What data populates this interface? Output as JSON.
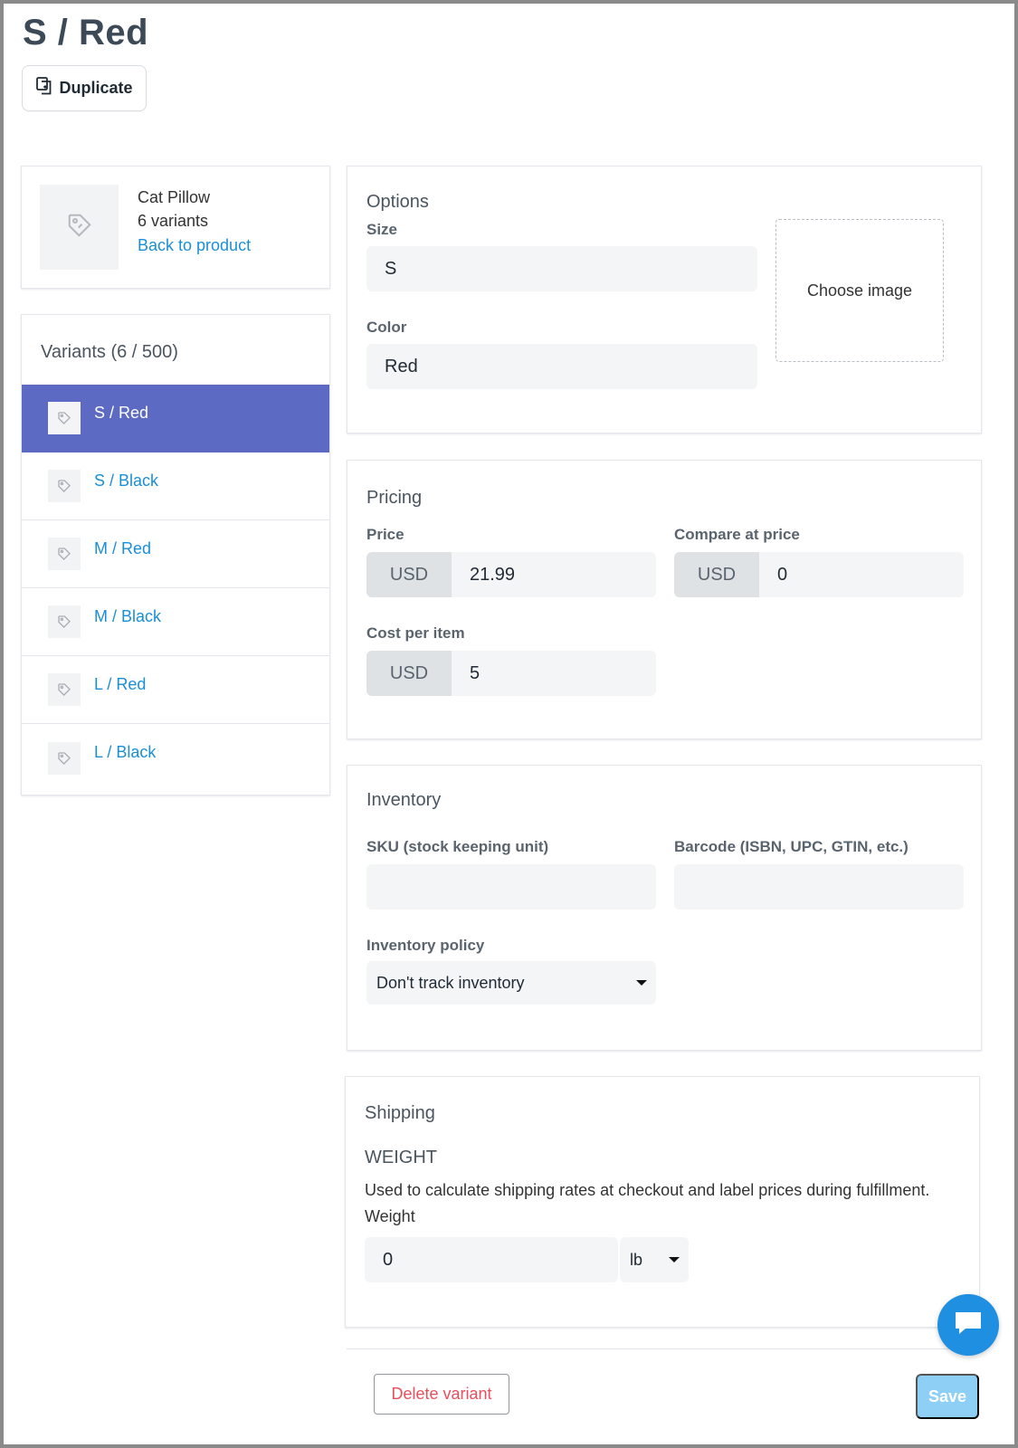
{
  "page": {
    "title": "S / Red",
    "duplicate_label": "Duplicate"
  },
  "product": {
    "name": "Cat Pillow",
    "variants_count": "6 variants",
    "back_link": "Back to product"
  },
  "variants": {
    "title": "Variants (6 / 500)",
    "items": [
      {
        "label": "S / Red",
        "active": true
      },
      {
        "label": "S / Black",
        "active": false
      },
      {
        "label": "M / Red",
        "active": false
      },
      {
        "label": "M / Black",
        "active": false
      },
      {
        "label": "L / Red",
        "active": false
      },
      {
        "label": "L / Black",
        "active": false
      }
    ]
  },
  "options": {
    "title": "Options",
    "size_label": "Size",
    "size_value": "S",
    "color_label": "Color",
    "color_value": "Red",
    "choose_image": "Choose image"
  },
  "pricing": {
    "title": "Pricing",
    "price_label": "Price",
    "price_currency": "USD",
    "price_value": "21.99",
    "compare_label": "Compare at price",
    "compare_currency": "USD",
    "compare_value": "0",
    "cost_label": "Cost per item",
    "cost_currency": "USD",
    "cost_value": "5"
  },
  "inventory": {
    "title": "Inventory",
    "sku_label": "SKU (stock keeping unit)",
    "sku_value": "",
    "barcode_label": "Barcode (ISBN, UPC, GTIN, etc.)",
    "barcode_value": "",
    "policy_label": "Inventory policy",
    "policy_value": "Don't track inventory"
  },
  "shipping": {
    "title": "Shipping",
    "weight_heading": "WEIGHT",
    "help_text": "Used to calculate shipping rates at checkout and label prices during fulfillment.",
    "weight_label": "Weight",
    "weight_value": "0",
    "weight_unit": "lb"
  },
  "actions": {
    "delete_label": "Delete variant",
    "save_label": "Save"
  },
  "colors": {
    "accent": "#5c6ac4",
    "link": "#1a8fd6",
    "danger": "#e84f5d",
    "save_disabled": "#8ed0f5",
    "chat": "#1e8fe1"
  },
  "icons": {
    "duplicate": "duplicate-icon",
    "product_thumb": "tag-icon",
    "variant_thumb": "tag-icon",
    "chat": "chat-icon"
  }
}
